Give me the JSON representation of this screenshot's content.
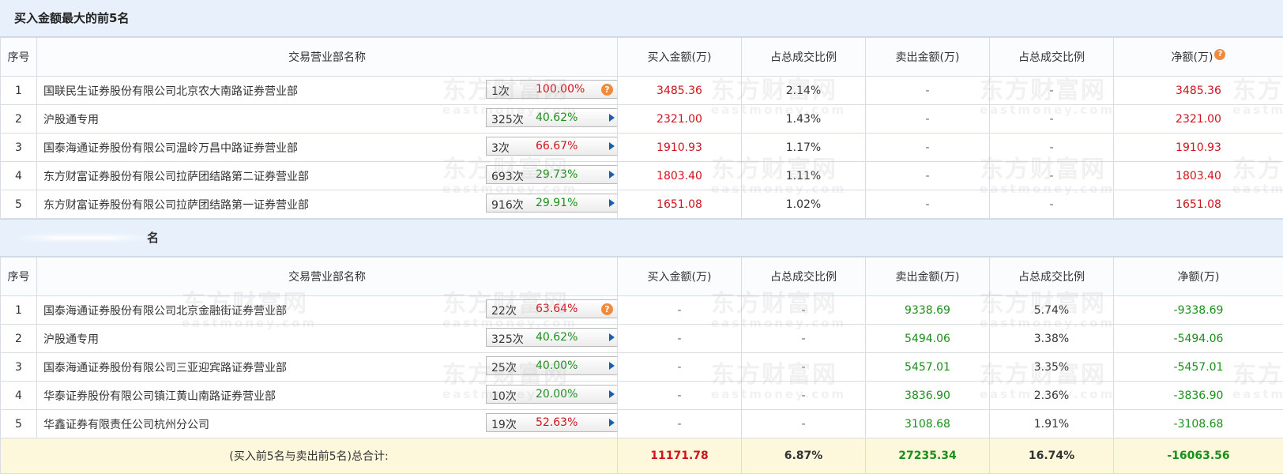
{
  "buy_section": {
    "title": "买入金额最大的前5名",
    "headers": [
      "序号",
      "交易营业部名称",
      "买入金额(万)",
      "占总成交比例",
      "卖出金额(万)",
      "占总成交比例",
      "净额(万)"
    ],
    "rows": [
      {
        "no": "1",
        "name": "国联民生证券股份有限公司北京农大南路证券营业部",
        "count": "1次",
        "pct": "100.00%",
        "buy": "3485.36",
        "buy_ratio": "2.14%",
        "sell": "-",
        "sell_ratio": "-",
        "net": "3485.36"
      },
      {
        "no": "2",
        "name": "沪股通专用",
        "count": "325次",
        "pct": "40.62%",
        "buy": "2321.00",
        "buy_ratio": "1.43%",
        "sell": "-",
        "sell_ratio": "-",
        "net": "2321.00"
      },
      {
        "no": "3",
        "name": "国泰海通证券股份有限公司温岭万昌中路证券营业部",
        "count": "3次",
        "pct": "66.67%",
        "buy": "1910.93",
        "buy_ratio": "1.17%",
        "sell": "-",
        "sell_ratio": "-",
        "net": "1910.93"
      },
      {
        "no": "4",
        "name": "东方财富证券股份有限公司拉萨团结路第二证券营业部",
        "count": "693次",
        "pct": "29.73%",
        "buy": "1803.40",
        "buy_ratio": "1.11%",
        "sell": "-",
        "sell_ratio": "-",
        "net": "1803.40"
      },
      {
        "no": "5",
        "name": "东方财富证券股份有限公司拉萨团结路第一证券营业部",
        "count": "916次",
        "pct": "29.91%",
        "buy": "1651.08",
        "buy_ratio": "1.02%",
        "sell": "-",
        "sell_ratio": "-",
        "net": "1651.08"
      }
    ]
  },
  "sell_section": {
    "title_visible_fragment": "名",
    "headers": [
      "序号",
      "交易营业部名称",
      "买入金额(万)",
      "占总成交比例",
      "卖出金额(万)",
      "占总成交比例",
      "净额(万)"
    ],
    "rows": [
      {
        "no": "1",
        "name": "国泰海通证券股份有限公司北京金融街证券营业部",
        "count": "22次",
        "pct": "63.64%",
        "buy": "-",
        "buy_ratio": "-",
        "sell": "9338.69",
        "sell_ratio": "5.74%",
        "net": "-9338.69"
      },
      {
        "no": "2",
        "name": "沪股通专用",
        "count": "325次",
        "pct": "40.62%",
        "buy": "-",
        "buy_ratio": "-",
        "sell": "5494.06",
        "sell_ratio": "3.38%",
        "net": "-5494.06"
      },
      {
        "no": "3",
        "name": "国泰海通证券股份有限公司三亚迎宾路证券营业部",
        "count": "25次",
        "pct": "40.00%",
        "buy": "-",
        "buy_ratio": "-",
        "sell": "5457.01",
        "sell_ratio": "3.35%",
        "net": "-5457.01"
      },
      {
        "no": "4",
        "name": "华泰证券股份有限公司镇江黄山南路证券营业部",
        "count": "10次",
        "pct": "20.00%",
        "buy": "-",
        "buy_ratio": "-",
        "sell": "3836.90",
        "sell_ratio": "2.36%",
        "net": "-3836.90"
      },
      {
        "no": "5",
        "name": "华鑫证券有限责任公司杭州分公司",
        "count": "19次",
        "pct": "52.63%",
        "buy": "-",
        "buy_ratio": "-",
        "sell": "3108.68",
        "sell_ratio": "1.91%",
        "net": "-3108.68"
      }
    ]
  },
  "total": {
    "label": "(买入前5名与卖出前5名)总合计:",
    "buy": "11171.78",
    "buy_ratio": "6.87%",
    "sell": "27235.34",
    "sell_ratio": "16.74%",
    "net": "-16063.56"
  },
  "help_glyph": "?",
  "watermark": {
    "cn": "东方财富网",
    "en": "eastmoney.com"
  },
  "colors": {
    "up": "#d0121b",
    "down": "#1b8f1b",
    "header_bg": "#e8f1fb",
    "total_bg": "#fdf7dc",
    "help": "#f08a3c",
    "arrow": "#1a5fa8"
  }
}
